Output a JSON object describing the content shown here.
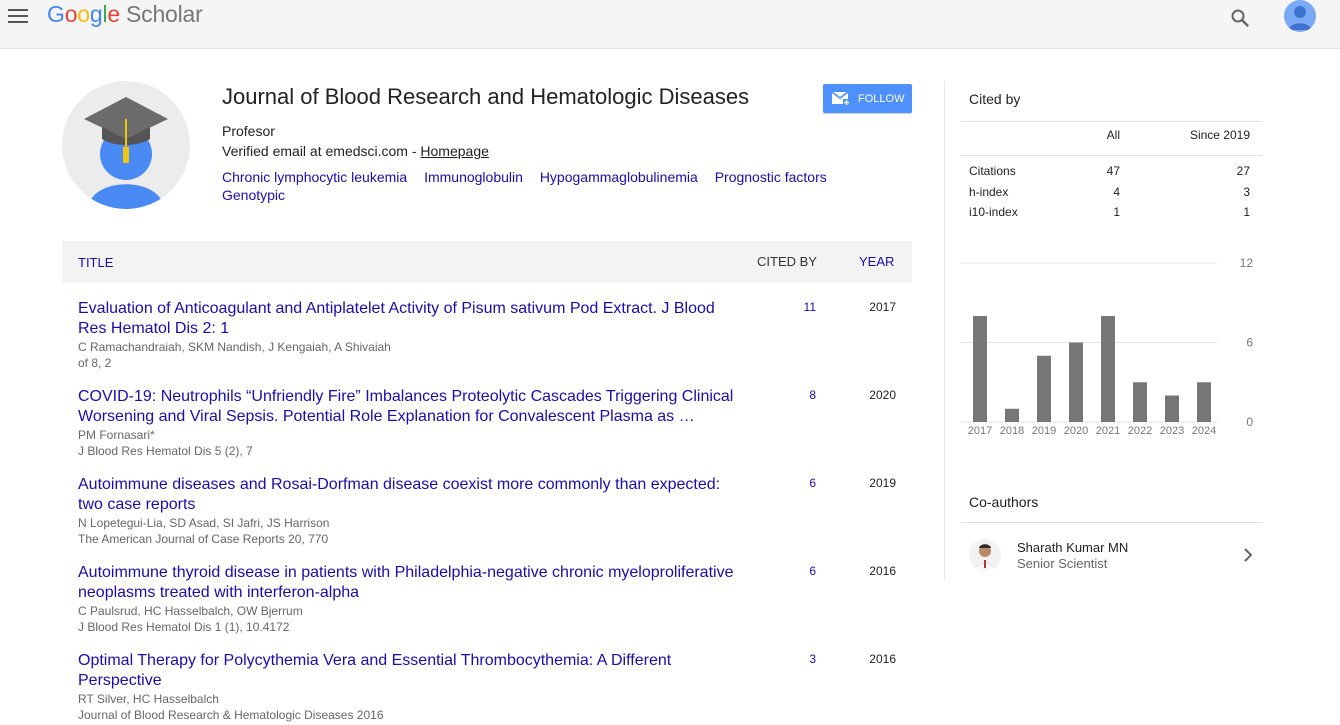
{
  "header": {
    "logo_letters": [
      "G",
      "o",
      "o",
      "g",
      "l",
      "e"
    ],
    "logo_product": "Scholar",
    "menu_icon": "hamburger-menu-icon",
    "search_icon": "search-icon",
    "account_icon": "account-avatar-icon",
    "brand_colors": [
      "#4285f4",
      "#ea4335",
      "#fbbc05",
      "#4285f4",
      "#34a853",
      "#ea4335"
    ]
  },
  "profile": {
    "name": "Journal of Blood Research and Hematologic Diseases",
    "affiliation": "Profesor",
    "verified_email": "Verified email at emedsci.com - ",
    "homepage_link": "Homepage",
    "follow_label": "FOLLOW",
    "interests": [
      "Chronic lymphocytic leukemia",
      "Immunoglobulin",
      "Hypogammaglobulinemia",
      "Prognostic factors",
      "Genotypic"
    ]
  },
  "table": {
    "col_title": "TITLE",
    "col_cited": "CITED BY",
    "col_year": "YEAR",
    "articles": [
      {
        "title": "Evaluation of Anticoagulant and Antiplatelet Activity of Pisum sativum Pod Extract. J Blood Res Hematol Dis 2: 1",
        "authors": "C Ramachandraiah, SKM Nandish, J Kengaiah, A Shivaiah",
        "venue": "of 8, 2",
        "cited": "11",
        "year": "2017"
      },
      {
        "title": "COVID-19: Neutrophils “Unfriendly Fire” Imbalances Proteolytic Cascades Triggering Clinical Worsening and Viral Sepsis. Potential Role Explanation for Convalescent Plasma as …",
        "authors": "PM Fornasari*",
        "venue": "J Blood Res Hematol Dis 5 (2), 7",
        "cited": "8",
        "year": "2020"
      },
      {
        "title": "Autoimmune diseases and Rosai-Dorfman disease coexist more commonly than expected: two case reports",
        "authors": "N Lopetegui-Lia, SD Asad, SI Jafri, JS Harrison",
        "venue": "The American Journal of Case Reports 20, 770",
        "cited": "6",
        "year": "2019"
      },
      {
        "title": "Autoimmune thyroid disease in patients with Philadelphia-negative chronic myeloproliferative neoplasms treated with interferon-alpha",
        "authors": "C Paulsrud, HC Hasselbalch, OW Bjerrum",
        "venue": "J Blood Res Hematol Dis 1 (1), 10.4172",
        "cited": "6",
        "year": "2016"
      },
      {
        "title": "Optimal Therapy for Polycythemia Vera and Essential Thrombocythemia: A Different Perspective",
        "authors": "RT Silver, HC Hasselbalch",
        "venue": "Journal of Blood Research & Hematologic Diseases 2016",
        "cited": "3",
        "year": "2016"
      }
    ]
  },
  "cited_by": {
    "title": "Cited by",
    "col_all": "All",
    "col_since": "Since 2019",
    "rows": [
      {
        "label": "Citations",
        "all": "47",
        "since": "27"
      },
      {
        "label": "h-index",
        "all": "4",
        "since": "3"
      },
      {
        "label": "i10-index",
        "all": "1",
        "since": "1"
      }
    ]
  },
  "chart_data": {
    "type": "bar",
    "categories": [
      "2017",
      "2018",
      "2019",
      "2020",
      "2021",
      "2022",
      "2023",
      "2024"
    ],
    "values": [
      8,
      1,
      5,
      6,
      8,
      3,
      2,
      3
    ],
    "ylim": [
      0,
      12
    ],
    "yticks": [
      "12",
      "6",
      "0"
    ],
    "bar_color": "#777777",
    "grid": true
  },
  "coauthors": {
    "title": "Co-authors",
    "items": [
      {
        "name": "Sharath Kumar MN",
        "role": "Senior Scientist"
      }
    ]
  }
}
